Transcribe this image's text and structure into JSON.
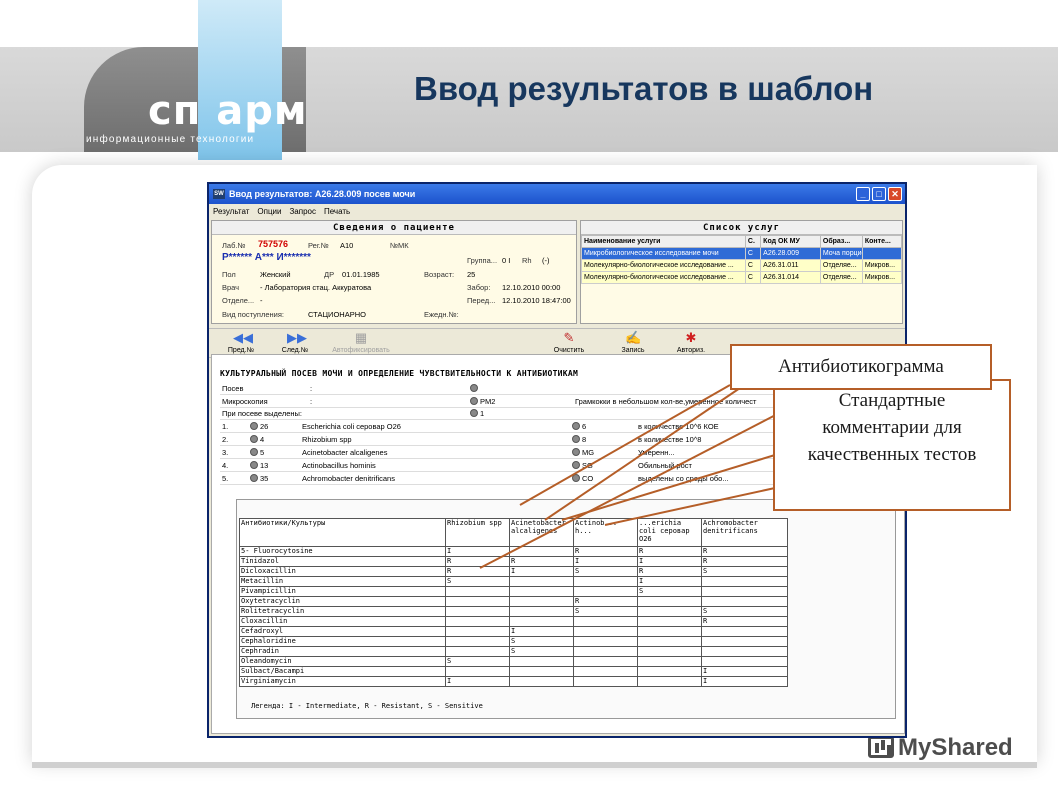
{
  "slide": {
    "title": "Ввод результатов в шаблон",
    "logo": "сп арм",
    "logo_subtitle": "информационные технологии",
    "watermark": "MyShared"
  },
  "window": {
    "title": "Ввод результатов: A26.28.009 посев мочи",
    "controls": [
      "_",
      "□",
      "✕"
    ],
    "menu": [
      "Результат",
      "Опции",
      "Запрос",
      "Печать"
    ]
  },
  "patient": {
    "header": "Сведения о пациенте",
    "lab_label": "Лаб.№",
    "lab_value": "757576",
    "reg_label": "Рег.№",
    "reg_value": "A10",
    "mk_label": "№МК",
    "name": "Р****** А*** И*******",
    "group_label": "Группа...",
    "group_value": "0 I",
    "rh_label": "Rh",
    "rh_value": "(-)",
    "sex_label": "Пол",
    "sex_value": "Женский",
    "dob_label": "ДР",
    "dob_value": "01.01.1985",
    "age_label": "Возраст:",
    "age_value": "25",
    "doctor_label": "Врач",
    "doctor_value": "- Лаборатория стац. Аккуратова",
    "draw_label": "Забор:",
    "draw_value": "12.10.2010 00:00",
    "dept_label": "Отделе...",
    "dept_value": "-",
    "transfer_label": "Перед...",
    "transfer_value": "12.10.2010 18:47:00",
    "admission_label": "Вид поступления:",
    "admission_value": "СТАЦИОНАРНО",
    "daily_label": "Ежедн.№:"
  },
  "services": {
    "header": "Список услуг",
    "columns": [
      "Наименование услуги",
      "С.",
      "Код ОК МУ",
      "Образ...",
      "Конте..."
    ],
    "rows": [
      [
        "Микробиологическое исследование мочи",
        "С",
        "A26.28.009",
        "Моча порционная",
        ""
      ],
      [
        "Молекулярно-биологическое исследование ...",
        "С",
        "A26.31.011",
        "Отделяе...",
        "Микров..."
      ],
      [
        "Молекулярно-биологическое исследование ...",
        "С",
        "A26.31.014",
        "Отделяе...",
        "Микров..."
      ]
    ]
  },
  "toolbar": {
    "prev": "Пред.№",
    "next": "След.№",
    "disabled": "Автофиксировать",
    "clear": "Очистить",
    "save": "Запись",
    "authorize": "Авториз."
  },
  "culture": {
    "title": "КУЛЬТУРАЛЬНЫЙ ПОСЕВ МОЧИ И ОПРЕДЕЛЕНИЕ ЧУВСТВИТЕЛЬНОСТИ К АНТИБИОТИКАМ",
    "rows": [
      {
        "label": "Посев",
        "sep": ":",
        "code": "",
        "text": ""
      },
      {
        "label": "Микроскопия",
        "sep": ":",
        "code": "PM2",
        "text": "Грамкокки в небольшом кол-ве,умеренное количест"
      },
      {
        "label": "При посеве выделены:",
        "sep": "",
        "code": "1",
        "text": ""
      }
    ],
    "organisms": [
      {
        "n": "1.",
        "code": "26",
        "name": "Escherichia coli серовар O26",
        "q": "6",
        "qtext": "в количестве 10^6 КОЕ"
      },
      {
        "n": "2.",
        "code": "4",
        "name": "Rhizobium spp",
        "q": "8",
        "qtext": "в количестве 10^8"
      },
      {
        "n": "3.",
        "code": "5",
        "name": "Acinetobacter alcaligenes",
        "q": "MG",
        "qtext": "Умеренн..."
      },
      {
        "n": "4.",
        "code": "13",
        "name": "Actinobacillus hominis",
        "q": "SG",
        "qtext": "Обильный рост"
      },
      {
        "n": "5.",
        "code": "35",
        "name": "Achromobacter denitrificans",
        "q": "CO",
        "qtext": "выделены со среды обо..."
      }
    ]
  },
  "antibiogram": {
    "columns": [
      "Антибиотики/Культуры",
      "Rhizobium spp",
      "Acinetobacter alcaligenes",
      "Actinob... h...",
      "...erichia coli серовар O26",
      "Achromobacter denitrificans"
    ],
    "rows": [
      [
        "5- Fluorocytosine",
        "I",
        "",
        "R",
        "R",
        "R"
      ],
      [
        "Tinidazol",
        "R",
        "R",
        "I",
        "I",
        "R"
      ],
      [
        "Dicloxacillin",
        "R",
        "I",
        "S",
        "R",
        "S"
      ],
      [
        "Metacillin",
        "S",
        "",
        "",
        "I",
        ""
      ],
      [
        "Pivampicillin",
        "",
        "",
        "",
        "S",
        ""
      ],
      [
        "Oxytetracyclin",
        "",
        "",
        "R",
        "",
        ""
      ],
      [
        "Rolitetracyclin",
        "",
        "",
        "S",
        "",
        "S"
      ],
      [
        "Cloxacillin",
        "",
        "",
        "",
        "",
        "R"
      ],
      [
        "Cefadroxyl",
        "",
        "I",
        "",
        "",
        ""
      ],
      [
        "Cephaloridine",
        "",
        "S",
        "",
        "",
        ""
      ],
      [
        "Cephradin",
        "",
        "S",
        "",
        "",
        ""
      ],
      [
        "Oleandomycin",
        "S",
        "",
        "",
        "",
        ""
      ],
      [
        "Sulbact/Bacampi",
        "",
        "",
        "",
        "",
        "I"
      ],
      [
        "Virginiamycin",
        "I",
        "",
        "",
        "",
        "I"
      ]
    ],
    "legend": "Легенда: I - Intermediate, R - Resistant, S - Sensitive"
  },
  "callouts": {
    "antibiogram": "Антибиотикограмма",
    "comments_line1": "Стандартные",
    "comments_line2": "комментарии для",
    "comments_line3": "качественных тестов"
  },
  "colors": {
    "title": "#17375e",
    "callout_border": "#b55e28",
    "titlebar": "#1c52cc",
    "selected_row": "#2f6bd6"
  }
}
